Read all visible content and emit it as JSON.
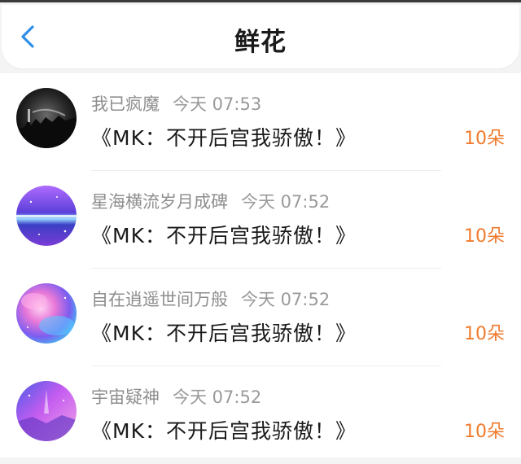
{
  "header": {
    "title": "鲜花",
    "back_icon": "chevron-left-icon",
    "accent": "#2f8fe8"
  },
  "colors": {
    "count": "#f07a2c",
    "name": "#8e8e8e",
    "book": "#1a1a1a"
  },
  "rows": [
    {
      "user": "我已疯魔",
      "time": "今天 07:53",
      "book": "《MK：不开后宫我骄傲！》",
      "count": "10朵",
      "avatar_icon": "dark-city-avatar"
    },
    {
      "user": "星海横流岁月成碑",
      "time": "今天 07:52",
      "book": "《MK：不开后宫我骄傲！》",
      "count": "10朵",
      "avatar_icon": "purple-galaxy-avatar"
    },
    {
      "user": "自在逍遥世间万般",
      "time": "今天 07:52",
      "book": "《MK：不开后宫我骄傲！》",
      "count": "10朵",
      "avatar_icon": "pink-nebula-avatar"
    },
    {
      "user": "宇宙疑神",
      "time": "今天 07:52",
      "book": "《MK：不开后宫我骄傲！》",
      "count": "10朵",
      "avatar_icon": "violet-space-avatar"
    }
  ]
}
